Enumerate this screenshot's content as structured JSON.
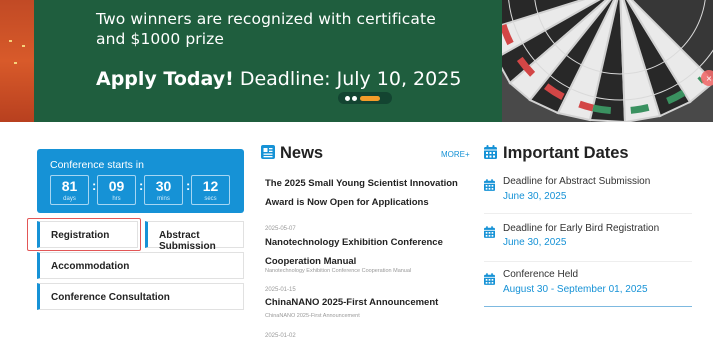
{
  "banner": {
    "line1": "Two winners are recognized with certificate",
    "line2": "and $1000 prize",
    "apply_bold": "Apply Today!",
    "apply_rest": " Deadline: July 10, 2025"
  },
  "countdown": {
    "title": "Conference starts in",
    "days": "81",
    "hrs": "09",
    "mins": "30",
    "secs": "12",
    "units": {
      "days": "days",
      "hrs": "hrs",
      "mins": "mins",
      "secs": "secs"
    },
    "separator": ":"
  },
  "left_buttons": {
    "registration": "Registration",
    "abstract_submission": "Abstract Submission",
    "accommodation": "Accommodation",
    "consultation": "Conference Consultation"
  },
  "news": {
    "heading": "News",
    "more": "MORE+",
    "items": [
      {
        "date": "",
        "title1": "The 2025 Small Young Scientist Innovation",
        "title2": "Award is Now Open for Applications",
        "sub": ""
      },
      {
        "date": "2025-05-07",
        "title1": "Nanotechnology Exhibition Conference",
        "title2": "Cooperation Manual",
        "sub": "Nanotechnology Exhibition Conference Cooperation Manual"
      },
      {
        "date": "2025-01-15",
        "title1": "ChinaNANO 2025-First Announcement",
        "title2": "",
        "sub": "ChinaNANO 2025-First Announcement"
      },
      {
        "date": "2025-01-02",
        "title1": "",
        "title2": "",
        "sub": ""
      }
    ]
  },
  "important_dates": {
    "heading": "Important Dates",
    "items": [
      {
        "label": "Deadline for Abstract Submission",
        "value": "June 30, 2025"
      },
      {
        "label": "Deadline for Early Bird Registration",
        "value": "June 30, 2025"
      },
      {
        "label": "Conference Held",
        "value": "August 30 - September 01, 2025"
      }
    ]
  },
  "colors": {
    "accent_blue": "#1692d6",
    "banner_green": "#1f5e3e",
    "highlight_red": "#e25656",
    "pager_orange": "#f39c2a"
  },
  "icons": {
    "news": "news-icon",
    "dates": "calendar-icon"
  }
}
